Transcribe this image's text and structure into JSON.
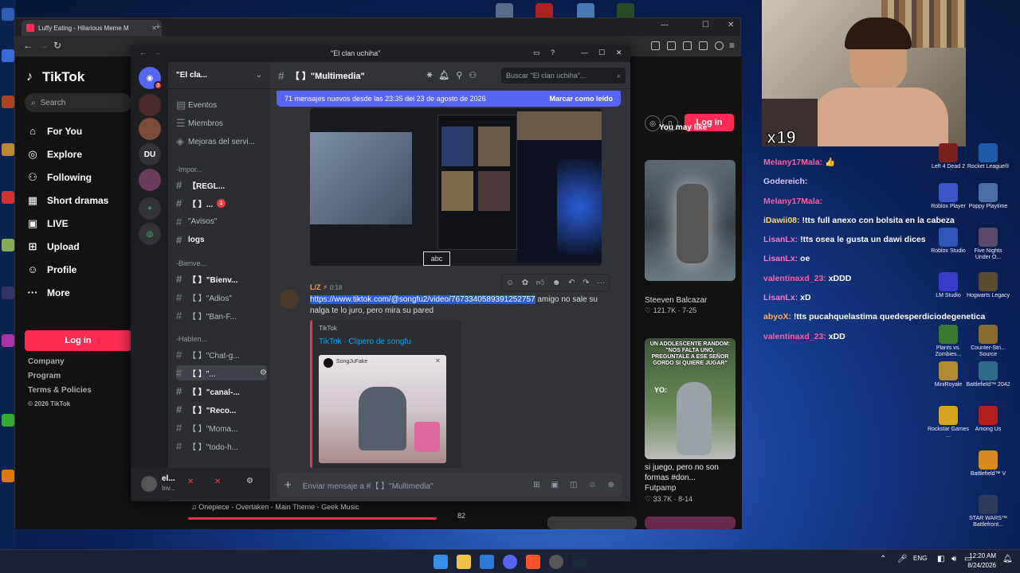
{
  "browser": {
    "tab_title": "Luffy Eating - Hilarious Meme M",
    "tab_close": "✕",
    "new_tab": "+"
  },
  "tiktok": {
    "logo": "TikTok",
    "search_placeholder": "Search",
    "nav": [
      {
        "icon": "home-icon",
        "label": "For You"
      },
      {
        "icon": "compass-icon",
        "label": "Explore"
      },
      {
        "icon": "users-icon",
        "label": "Following"
      },
      {
        "icon": "film-icon",
        "label": "Short dramas"
      },
      {
        "icon": "live-icon",
        "label": "LIVE"
      },
      {
        "icon": "upload-icon",
        "label": "Upload"
      },
      {
        "icon": "profile-icon",
        "label": "Profile"
      },
      {
        "icon": "more-icon",
        "label": "More"
      }
    ],
    "login": "Log in",
    "footer": [
      "Company",
      "Program",
      "Terms & Policies",
      "© 2026 TikTok"
    ],
    "right_login": "Log in",
    "you_may_like": "You may like",
    "videos": [
      {
        "author": "Steeven Balcazar",
        "likes": "121.7K",
        "date": "7-25"
      },
      {
        "overlay": "UN ADOLESCENTE RANDOM: \"NOS FALTA UNO, PREGUNTALE A ESE SEÑOR GORDO SI QUIERE JUGAR\"",
        "overlay2": "YO:",
        "title": "si juego, pero no son formas #don...",
        "author": "Futpamp",
        "likes": "33.7K",
        "date": "8-14"
      }
    ],
    "music": "Onepiece - Overtaken - Main Theme - Geek Music",
    "music_num": "82"
  },
  "discord": {
    "window_title": "\"El clan uchiha\"",
    "server_name": "\"El cla...",
    "channels_top": [
      "Eventos",
      "Miembros",
      "Mejoras del servi..."
    ],
    "categories": [
      "-Impor...",
      "-Bienve...",
      "-Hablen..."
    ],
    "channels": [
      "【REGL...",
      "【 】...",
      "\"Avisos\"",
      "logs",
      "【 】\"Bienv...",
      "【 】\"Adios\"",
      "【 】\"Ban-F...",
      "【 】\"Chat-g...",
      "【 】\"...",
      "【 】\"canal-...",
      "【 】\"Reco...",
      "【 】\"Moma...",
      "【 】\"todo-h..."
    ],
    "badge": "1",
    "server_du": "DU",
    "user_name": "el...",
    "user_status": "Inv...",
    "channel_title": "【 】\"Multimedia\"",
    "search_placeholder": "Buscar \"El clan uchiha\"...",
    "new_messages": "71 mensajes nuevos desde las 23:35 del 23 de agosto de 2026",
    "mark_read": "Marcar como leído",
    "author": "L/Z ⚡",
    "time": "0:18",
    "link": "https://www.tiktok.com/@songfu2/video/7673340589391252757",
    "message_rest": " amigo no sale su nalga te lo juro, pero mira su pared",
    "embed_provider": "TikTok",
    "embed_title": "TikTok · Clipero de songfu",
    "embed_user": "SongJuFake",
    "abc_label": "abc",
    "compose_placeholder": "Enviar mensaje a #【 】\"Multimedia\""
  },
  "stream_chat": [
    {
      "user": "Melany17Mala:",
      "msg": " 👍",
      "cls": "n"
    },
    {
      "user": "Godereich:",
      "msg": "",
      "cls": "g"
    },
    {
      "user": "Melany17Mala:",
      "msg": "",
      "cls": "n"
    },
    {
      "user": "iDawii08:",
      "msg": " !tts full anexo con bolsita en la cabeza",
      "cls": "t"
    },
    {
      "user": "LisanLx:",
      "msg": " !tts osea le gusta un dawi dices",
      "cls": "p"
    },
    {
      "user": "LisanLx:",
      "msg": " oe",
      "cls": "p"
    },
    {
      "user": "valentinaxd_23:",
      "msg": " xDDD",
      "cls": "v"
    },
    {
      "user": "LisanLx:",
      "msg": " xD",
      "cls": "p"
    },
    {
      "user": "abyoX:",
      "msg": " !tts pucahquelastima quedesperdiciodegenetica",
      "cls": "o"
    },
    {
      "user": "valentinaxd_23:",
      "msg": " xDD",
      "cls": "v"
    }
  ],
  "cam_overlay": "x19",
  "desktop_icons": [
    {
      "label": "Left 4 Dead 2",
      "color": "#7a1f1f"
    },
    {
      "label": "Rocket League®",
      "color": "#1f5aa8"
    },
    {
      "label": "Roblox Player",
      "color": "#3b56c7"
    },
    {
      "label": "Poppy Playtime",
      "color": "#4a6fa5"
    },
    {
      "label": "Roblox Studio",
      "color": "#2e56b8"
    },
    {
      "label": "Five Nights Under O...",
      "color": "#5b4a6a"
    },
    {
      "label": "LM Studio",
      "color": "#3a3acb"
    },
    {
      "label": "Hogwarts Legacy",
      "color": "#5a4a2f"
    },
    {
      "label": "Plants vs. Zombies...",
      "color": "#3a7a2f"
    },
    {
      "label": "Counter-Stri... Source",
      "color": "#8a6a2f"
    },
    {
      "label": "MiniRoyale",
      "color": "#b28a2f"
    },
    {
      "label": "Battlefield™ 2042",
      "color": "#2f6a8a"
    },
    {
      "label": "Rockstar Games ...",
      "color": "#d6a51f"
    },
    {
      "label": "Among Us",
      "color": "#b21f1f"
    },
    {
      "label": "Battlefield™ V",
      "color": "#d68a1f"
    },
    {
      "label": "STAR WARS™ Battlefront...",
      "color": "#2f3a5a"
    }
  ],
  "taskbar": {
    "lang": "ENG",
    "time": "12:20 AM",
    "date": "8/24/2026"
  },
  "colors": {
    "tiktok_red": "#fe2c55",
    "discord_blurple": "#5865f2",
    "discord_bg": "#313338"
  }
}
